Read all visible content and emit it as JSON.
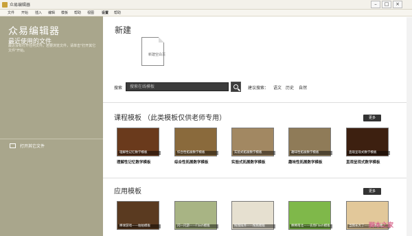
{
  "window": {
    "title": "众易编辑器"
  },
  "menu": [
    "文件",
    "开始",
    "插入",
    "编辑",
    "模板",
    "帮助",
    "视图",
    "设置",
    "帮助"
  ],
  "menu_active_index": 7,
  "sidebar": {
    "title": "众易编辑器",
    "subtitle": "最近使用的文件",
    "description": "最近没有打开任何文件。若要浏览文件，请单击\"打开其它文件\"开始。",
    "open_other": "打开其它文件"
  },
  "main": {
    "title": "新建",
    "new_doc_label": "新建空白页",
    "search_label": "搜索",
    "search_placeholder": "搜索在线模板",
    "suggest_label": "建议搜索：",
    "suggestions": [
      "语文",
      "历史",
      "自然"
    ]
  },
  "sections": [
    {
      "title": "课程模板 （此类模板仅供老师专用）",
      "more": "更多",
      "cards": [
        {
          "label": "理解性记忆数学模板",
          "caption": "理解性记忆数学模板",
          "color": "#6a3a1c"
        },
        {
          "label": "综合性拓展数学模板",
          "caption": "综合性拓展数学模板",
          "color": "#8a6a3c"
        },
        {
          "label": "实验式拓展数学模板",
          "caption": "实验式拓展数学模板",
          "color": "#a28862"
        },
        {
          "label": "趣味性拓展数学模板",
          "caption": "趣味性拓展数学模板",
          "color": "#8f7b58"
        },
        {
          "label": "直观呈现式数学模板",
          "caption": "直观呈现式数学模板",
          "color": "#3d2010"
        }
      ]
    },
    {
      "title": "应用模板",
      "more": "更多",
      "cards": [
        {
          "caption": "棒球游戏——拍拍模板",
          "color": "#5a3a20"
        },
        {
          "caption": "闪一闪游——Flash模板",
          "color": "#a8b484"
        },
        {
          "caption": "拖拽排序——拖拖模板",
          "color": "#e6e0d0"
        },
        {
          "caption": "棒棒南北——农场Flash模板",
          "color": "#7fb84a"
        },
        {
          "caption": "当我长大了——英语模板",
          "color": "#e2c89a"
        }
      ]
    }
  ],
  "watermark": "脚本之家"
}
